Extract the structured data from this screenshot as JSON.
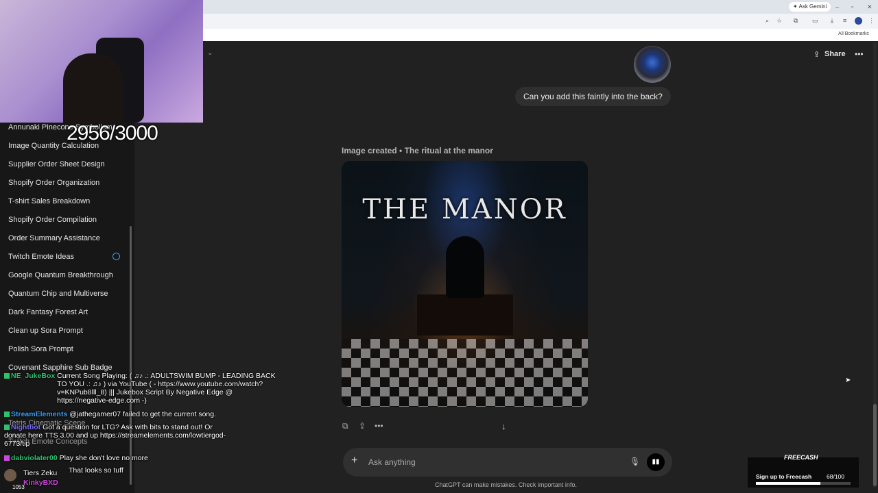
{
  "browser": {
    "ask_gemini": "✦ Ask Gemini",
    "all_bookmarks": "All Bookmarks"
  },
  "sidebar": {
    "items": [
      {
        "label": "Annunaki Pinecone Symbolism"
      },
      {
        "label": "Image Quantity Calculation"
      },
      {
        "label": "Supplier Order Sheet Design"
      },
      {
        "label": "Shopify Order Organization"
      },
      {
        "label": "T-shirt Sales Breakdown"
      },
      {
        "label": "Shopify Order Compilation"
      },
      {
        "label": "Order Summary Assistance"
      },
      {
        "label": "Twitch Emote Ideas"
      },
      {
        "label": "Google Quantum Breakthrough"
      },
      {
        "label": "Quantum Chip and Multiverse"
      },
      {
        "label": "Dark Fantasy Forest Art"
      },
      {
        "label": "Clean up Sora Prompt"
      },
      {
        "label": "Polish Sora Prompt"
      },
      {
        "label": "Covenant Sapphire Sub Badge"
      }
    ],
    "hidden_items": [
      "Tetris Cinematic Scene",
      "Twitch Emote Concepts"
    ]
  },
  "header": {
    "share_label": "Share",
    "more_icon": "ellipsis-icon"
  },
  "conversation": {
    "user_message": "Can you add this faintly into the back?",
    "image_caption": "Image created • The ritual at the manor",
    "image_title_text": "THE MANOR"
  },
  "composer": {
    "placeholder": "Ask anything",
    "disclaimer": "ChatGPT can make mistakes. Check important info."
  },
  "overlay": {
    "counter": "2956/3000",
    "chat": [
      {
        "user": "NE_JukeBox",
        "user_color": "#2ec270",
        "text": "Current Song Playing: ( ♫♪ .: ADULTSWIM BUMP - LEADING BACK TO YOU .: ♫♪ ) via YouTube ( - https://www.youtube.com/watch?v=KNPub8lll_8) ||| Jukebox Script By Negative Edge @ https://negative-edge.com -)"
      },
      {
        "user": "StreamElements",
        "user_color": "#3b9ff5",
        "text": "@jathegamer07 failed to get the current song."
      },
      {
        "user": "Nightbot",
        "user_color": "#7a6cf0",
        "text": "Got a question for LTG? Ask with bits to stand out! Or donate here TTS 3.00 and up https://streamelements.com/lowtiergod-6773/tip"
      },
      {
        "user": "dabviolater00",
        "user_color": "#2ec270",
        "text": "Play she don't love no more"
      },
      {
        "user": "",
        "user_color": "#2ec270",
        "text": "That looks so tuff"
      },
      {
        "user": "KinkyBXD",
        "user_color": "#c94ad8",
        "text": ""
      }
    ],
    "chat_extra": "Tiers Zeku",
    "chat_count": "1053"
  },
  "freecash": {
    "logo": "FREECASH",
    "signup": "Sign up to Freecash",
    "progress_text": "68/100",
    "progress": 0.68
  }
}
